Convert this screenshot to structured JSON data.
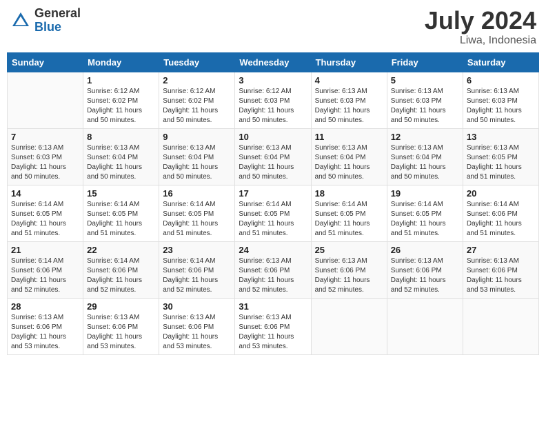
{
  "logo": {
    "general": "General",
    "blue": "Blue"
  },
  "title": {
    "month_year": "July 2024",
    "location": "Liwa, Indonesia"
  },
  "calendar": {
    "headers": [
      "Sunday",
      "Monday",
      "Tuesday",
      "Wednesday",
      "Thursday",
      "Friday",
      "Saturday"
    ],
    "weeks": [
      [
        {
          "day": "",
          "sunrise": "",
          "sunset": "",
          "daylight": ""
        },
        {
          "day": "1",
          "sunrise": "Sunrise: 6:12 AM",
          "sunset": "Sunset: 6:02 PM",
          "daylight": "Daylight: 11 hours and 50 minutes."
        },
        {
          "day": "2",
          "sunrise": "Sunrise: 6:12 AM",
          "sunset": "Sunset: 6:02 PM",
          "daylight": "Daylight: 11 hours and 50 minutes."
        },
        {
          "day": "3",
          "sunrise": "Sunrise: 6:12 AM",
          "sunset": "Sunset: 6:03 PM",
          "daylight": "Daylight: 11 hours and 50 minutes."
        },
        {
          "day": "4",
          "sunrise": "Sunrise: 6:13 AM",
          "sunset": "Sunset: 6:03 PM",
          "daylight": "Daylight: 11 hours and 50 minutes."
        },
        {
          "day": "5",
          "sunrise": "Sunrise: 6:13 AM",
          "sunset": "Sunset: 6:03 PM",
          "daylight": "Daylight: 11 hours and 50 minutes."
        },
        {
          "day": "6",
          "sunrise": "Sunrise: 6:13 AM",
          "sunset": "Sunset: 6:03 PM",
          "daylight": "Daylight: 11 hours and 50 minutes."
        }
      ],
      [
        {
          "day": "7",
          "sunrise": "Sunrise: 6:13 AM",
          "sunset": "Sunset: 6:03 PM",
          "daylight": "Daylight: 11 hours and 50 minutes."
        },
        {
          "day": "8",
          "sunrise": "Sunrise: 6:13 AM",
          "sunset": "Sunset: 6:04 PM",
          "daylight": "Daylight: 11 hours and 50 minutes."
        },
        {
          "day": "9",
          "sunrise": "Sunrise: 6:13 AM",
          "sunset": "Sunset: 6:04 PM",
          "daylight": "Daylight: 11 hours and 50 minutes."
        },
        {
          "day": "10",
          "sunrise": "Sunrise: 6:13 AM",
          "sunset": "Sunset: 6:04 PM",
          "daylight": "Daylight: 11 hours and 50 minutes."
        },
        {
          "day": "11",
          "sunrise": "Sunrise: 6:13 AM",
          "sunset": "Sunset: 6:04 PM",
          "daylight": "Daylight: 11 hours and 50 minutes."
        },
        {
          "day": "12",
          "sunrise": "Sunrise: 6:13 AM",
          "sunset": "Sunset: 6:04 PM",
          "daylight": "Daylight: 11 hours and 50 minutes."
        },
        {
          "day": "13",
          "sunrise": "Sunrise: 6:13 AM",
          "sunset": "Sunset: 6:05 PM",
          "daylight": "Daylight: 11 hours and 51 minutes."
        }
      ],
      [
        {
          "day": "14",
          "sunrise": "Sunrise: 6:14 AM",
          "sunset": "Sunset: 6:05 PM",
          "daylight": "Daylight: 11 hours and 51 minutes."
        },
        {
          "day": "15",
          "sunrise": "Sunrise: 6:14 AM",
          "sunset": "Sunset: 6:05 PM",
          "daylight": "Daylight: 11 hours and 51 minutes."
        },
        {
          "day": "16",
          "sunrise": "Sunrise: 6:14 AM",
          "sunset": "Sunset: 6:05 PM",
          "daylight": "Daylight: 11 hours and 51 minutes."
        },
        {
          "day": "17",
          "sunrise": "Sunrise: 6:14 AM",
          "sunset": "Sunset: 6:05 PM",
          "daylight": "Daylight: 11 hours and 51 minutes."
        },
        {
          "day": "18",
          "sunrise": "Sunrise: 6:14 AM",
          "sunset": "Sunset: 6:05 PM",
          "daylight": "Daylight: 11 hours and 51 minutes."
        },
        {
          "day": "19",
          "sunrise": "Sunrise: 6:14 AM",
          "sunset": "Sunset: 6:05 PM",
          "daylight": "Daylight: 11 hours and 51 minutes."
        },
        {
          "day": "20",
          "sunrise": "Sunrise: 6:14 AM",
          "sunset": "Sunset: 6:06 PM",
          "daylight": "Daylight: 11 hours and 51 minutes."
        }
      ],
      [
        {
          "day": "21",
          "sunrise": "Sunrise: 6:14 AM",
          "sunset": "Sunset: 6:06 PM",
          "daylight": "Daylight: 11 hours and 52 minutes."
        },
        {
          "day": "22",
          "sunrise": "Sunrise: 6:14 AM",
          "sunset": "Sunset: 6:06 PM",
          "daylight": "Daylight: 11 hours and 52 minutes."
        },
        {
          "day": "23",
          "sunrise": "Sunrise: 6:14 AM",
          "sunset": "Sunset: 6:06 PM",
          "daylight": "Daylight: 11 hours and 52 minutes."
        },
        {
          "day": "24",
          "sunrise": "Sunrise: 6:13 AM",
          "sunset": "Sunset: 6:06 PM",
          "daylight": "Daylight: 11 hours and 52 minutes."
        },
        {
          "day": "25",
          "sunrise": "Sunrise: 6:13 AM",
          "sunset": "Sunset: 6:06 PM",
          "daylight": "Daylight: 11 hours and 52 minutes."
        },
        {
          "day": "26",
          "sunrise": "Sunrise: 6:13 AM",
          "sunset": "Sunset: 6:06 PM",
          "daylight": "Daylight: 11 hours and 52 minutes."
        },
        {
          "day": "27",
          "sunrise": "Sunrise: 6:13 AM",
          "sunset": "Sunset: 6:06 PM",
          "daylight": "Daylight: 11 hours and 53 minutes."
        }
      ],
      [
        {
          "day": "28",
          "sunrise": "Sunrise: 6:13 AM",
          "sunset": "Sunset: 6:06 PM",
          "daylight": "Daylight: 11 hours and 53 minutes."
        },
        {
          "day": "29",
          "sunrise": "Sunrise: 6:13 AM",
          "sunset": "Sunset: 6:06 PM",
          "daylight": "Daylight: 11 hours and 53 minutes."
        },
        {
          "day": "30",
          "sunrise": "Sunrise: 6:13 AM",
          "sunset": "Sunset: 6:06 PM",
          "daylight": "Daylight: 11 hours and 53 minutes."
        },
        {
          "day": "31",
          "sunrise": "Sunrise: 6:13 AM",
          "sunset": "Sunset: 6:06 PM",
          "daylight": "Daylight: 11 hours and 53 minutes."
        },
        {
          "day": "",
          "sunrise": "",
          "sunset": "",
          "daylight": ""
        },
        {
          "day": "",
          "sunrise": "",
          "sunset": "",
          "daylight": ""
        },
        {
          "day": "",
          "sunrise": "",
          "sunset": "",
          "daylight": ""
        }
      ]
    ]
  }
}
